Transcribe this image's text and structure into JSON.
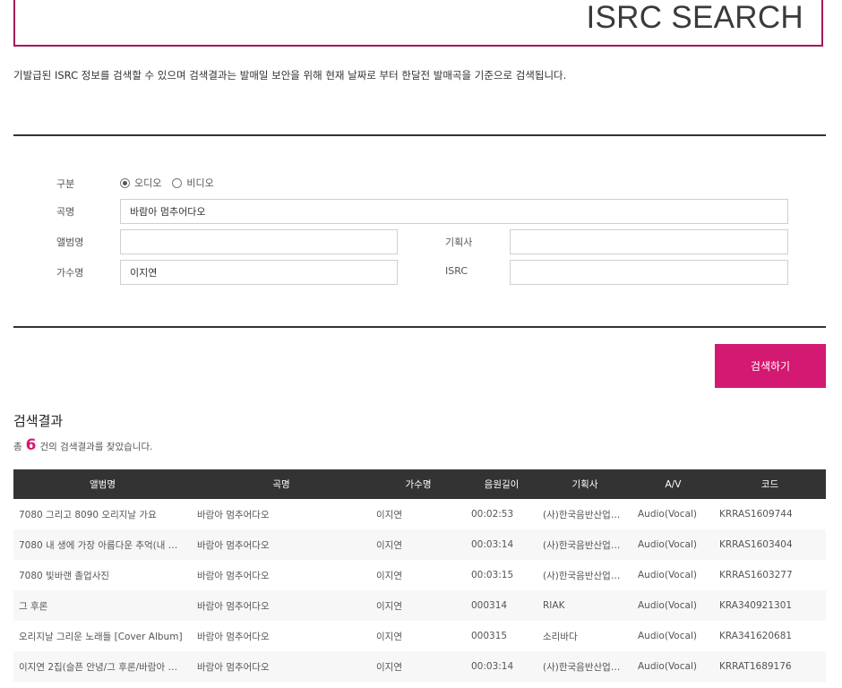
{
  "header": {
    "title": "ISRC SEARCH"
  },
  "intro": "기발급된 ISRC 정보를 검색할 수 있으며 검색결과는 발매일 보안을 위해 현재 날짜로 부터 한달전 발매곡을 기준으로 검색됩니다.",
  "form": {
    "type_label": "구분",
    "type_options": [
      "오디오",
      "비디오"
    ],
    "type_selected": "오디오",
    "title_label": "곡명",
    "title_value": "바람아 멈추어다오",
    "album_label": "앨범명",
    "album_value": "",
    "agency_label": "기획사",
    "agency_value": "",
    "artist_label": "가수명",
    "artist_value": "이지연",
    "isrc_label": "ISRC",
    "isrc_value": ""
  },
  "search_button": "검색하기",
  "results": {
    "title": "검색결과",
    "count_prefix": "총",
    "count": "6",
    "count_suffix": "건의 검색결과를 찾았습니다.",
    "columns": [
      "앨범명",
      "곡명",
      "가수명",
      "음원길이",
      "기획사",
      "A/V",
      "코드"
    ],
    "rows": [
      [
        "7080 그리고 8090 오리지날 가요",
        "바람아 멈추어다오",
        "이지연",
        "00:02:53",
        "(사)한국음반산업…",
        "Audio(Vocal)",
        "KRRAS1609744"
      ],
      [
        "7080 내 생에 가장 아름다운 추억(내 …",
        "바람아 멈추어다오",
        "이지연",
        "00:03:14",
        "(사)한국음반산업…",
        "Audio(Vocal)",
        "KRRAS1603404"
      ],
      [
        "7080 빛바랜 졸업사진",
        "바람아 멈추어다오",
        "이지연",
        "00:03:15",
        "(사)한국음반산업…",
        "Audio(Vocal)",
        "KRRAS1603277"
      ],
      [
        "그 후론",
        "바람아 멈추어다오",
        "이지연",
        "000314",
        "RIAK",
        "Audio(Vocal)",
        "KRA340921301"
      ],
      [
        "오리지날 그리운 노래들 [Cover Album]",
        "바람아 멈추어다오",
        "이지연",
        "000315",
        "소리바다",
        "Audio(Vocal)",
        "KRA341620681"
      ],
      [
        "이지연 2집(슬픈 안녕/그 후론/바람아 …",
        "바람아 멈추어다오",
        "이지연",
        "00:03:14",
        "(사)한국음반산업…",
        "Audio(Vocal)",
        "KRRAT1689176"
      ]
    ]
  },
  "colors": {
    "accent": "#d41972",
    "frame": "#a3185a",
    "table_header": "#333333"
  }
}
